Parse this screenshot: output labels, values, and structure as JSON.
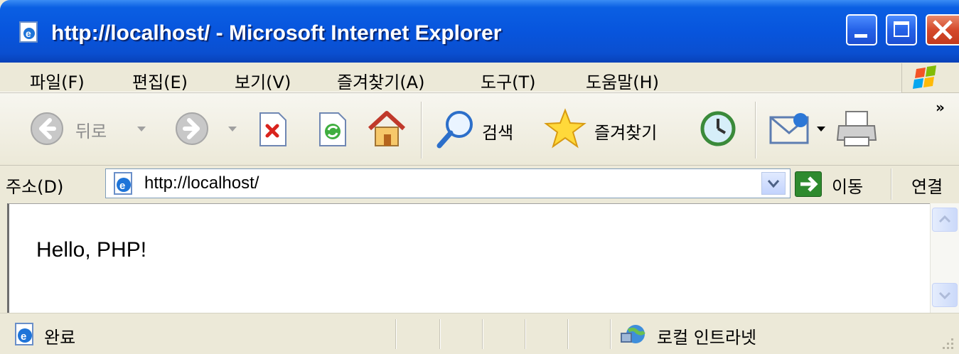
{
  "window": {
    "title": "http://localhost/ - Microsoft Internet Explorer",
    "controls": {
      "minimize": "minimize",
      "maximize": "maximize",
      "close": "close"
    }
  },
  "menubar": {
    "items": [
      {
        "label": "파일(F)"
      },
      {
        "label": "편집(E)"
      },
      {
        "label": "보기(V)"
      },
      {
        "label": "즐겨찾기(A)"
      },
      {
        "label": "도구(T)"
      },
      {
        "label": "도움말(H)"
      }
    ]
  },
  "toolbar": {
    "back_label": "뒤로",
    "search_label": "검색",
    "favorites_label": "즐겨찾기",
    "chevron": "»"
  },
  "addressbar": {
    "label": "주소(D)",
    "url": "http://localhost/",
    "go_label": "이동",
    "links_label": "연결"
  },
  "content": {
    "text": "Hello, PHP!"
  },
  "statusbar": {
    "status": "완료",
    "zone": "로컬 인트라넷"
  },
  "colors": {
    "titlebar": "#0855DD",
    "chrome": "#ECE9D8",
    "close_button": "#D5492B",
    "go_button": "#2E8A2E"
  }
}
